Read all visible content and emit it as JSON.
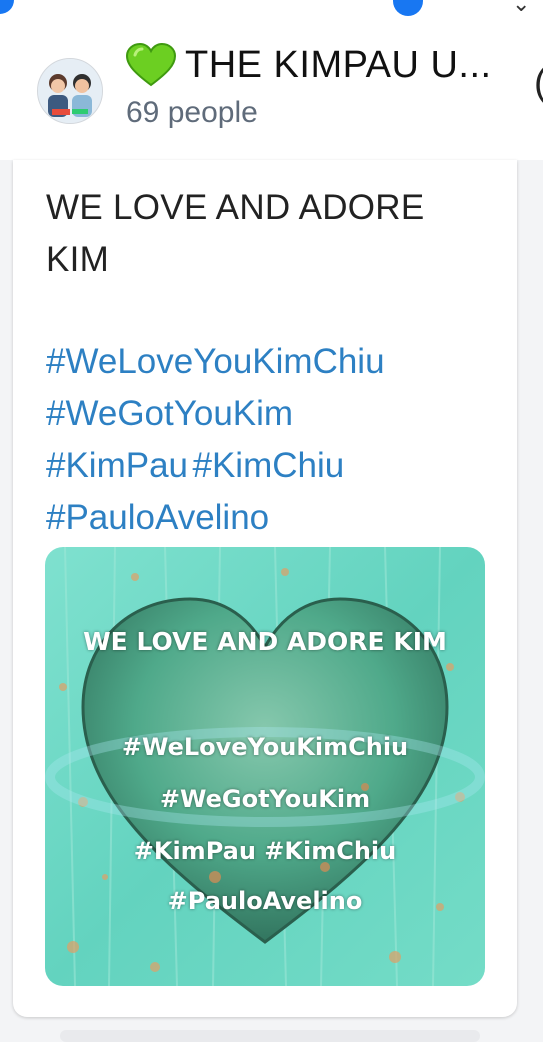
{
  "group": {
    "title": "THE KIMPAU U...",
    "member_count": "69 people",
    "title_emoji": "green-heart-icon"
  },
  "post": {
    "title_line1": "WE LOVE AND ADORE",
    "title_line2": "KIM",
    "hashtags": {
      "line1": "#WeLoveYouKimChiu",
      "line2": "#WeGotYouKim",
      "line3a": "#KimPau",
      "line3b": "#KimChiu",
      "line4": "#PauloAvelino"
    }
  },
  "image": {
    "heading": "WE LOVE AND ADORE KIM",
    "tag1": "#WeLoveYouKimChiu",
    "tag2": "#WeGotYouKim",
    "tag3": "#KimPau #KimChiu",
    "tag4": "#PauloAvelino",
    "colors": {
      "background": "#6fd6c3",
      "heart": "#4fa98a",
      "link": "#2d80c3"
    }
  }
}
